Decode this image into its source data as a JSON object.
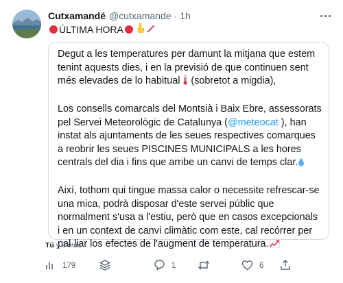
{
  "author": {
    "name": "Cutxamandé",
    "handle": "@cutxamande",
    "separator": "·",
    "time": "1h"
  },
  "headline": {
    "text": "ÚLTIMA HORA"
  },
  "quoted": {
    "p1_a": "Degut a les temperatures per damunt la mitjana que estem tenint aquests dies, i en la previsió de que continuen sent més elevades de lo habitual ",
    "p1_b": " (sobretot a migdia),",
    "p2_a": "Los consells comarcals del Montsià i Baix Ebre, assessorats pel Servei Meteorològic de Catalunya (",
    "p2_mention": "@meteocat",
    "p2_b": " ), han instat als ajuntaments de les seues respectives comarques a reobrir les seues PISCINES MUNICIPALS a les hores centrals del dia i fins que arribe un canvi de temps clar.",
    "p3": "Així, tothom qui tingue massa calor o necessite refrescar-se una mica, podrà disposar d'este servei públic que normalment s'usa a l'estiu, però que en casos excepcionals i en un context de canvi climàtic com este, cal recórrer per pal·liar los efectes de l'augment de temperatura."
  },
  "meta": {
    "you": "Tú",
    "ago": " y 9 más"
  },
  "actions": {
    "views": "179",
    "replies": "1",
    "likes": "6"
  },
  "colors": {
    "accent": "#1d9bf0",
    "muted": "#536471",
    "red": "#dd2e44"
  },
  "icons": [
    "avatar-landscape",
    "red-circle-icon",
    "hand-pointing-down-icon",
    "pencil-icon",
    "thermometer-icon",
    "droplet-icon",
    "chart-increasing-icon",
    "views-icon",
    "layers-icon",
    "reply-icon",
    "retweet-icon",
    "like-icon",
    "share-icon",
    "more-icon"
  ]
}
